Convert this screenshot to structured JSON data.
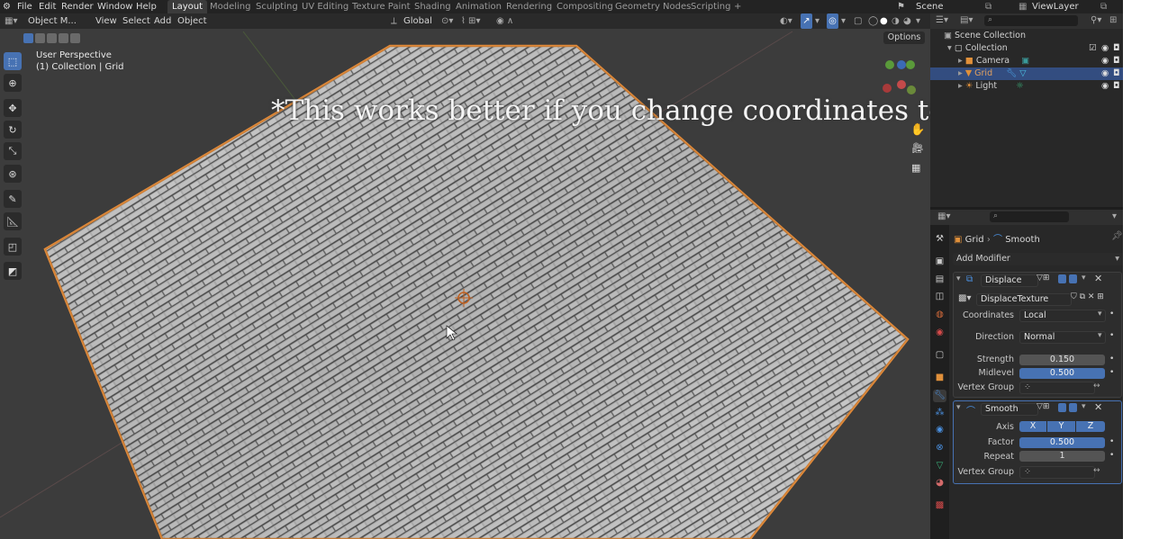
{
  "menu": [
    "File",
    "Edit",
    "Render",
    "Window",
    "Help"
  ],
  "workspaces": [
    "Layout",
    "Modeling",
    "Sculpting",
    "UV Editing",
    "Texture Paint",
    "Shading",
    "Animation",
    "Rendering",
    "Compositing",
    "Geometry Nodes",
    "Scripting",
    "+"
  ],
  "scene": "Scene",
  "view_layer": "ViewLayer",
  "viewport_header": {
    "mode": "Object M...",
    "items": [
      "View",
      "Select",
      "Add",
      "Object"
    ],
    "transform": "Global",
    "options": "Options"
  },
  "viewport": {
    "view_name": "User Perspective",
    "collection_label": "(1) Collection | Grid",
    "caption": "*This works better if you change coordinates to UV",
    "accent_color": "#4772b3"
  },
  "outliner": {
    "root": "Scene Collection",
    "collection": "Collection",
    "items": [
      {
        "name": "Camera",
        "icon": "camera-icon"
      },
      {
        "name": "Grid",
        "icon": "mesh-icon"
      },
      {
        "name": "Light",
        "icon": "light-icon"
      }
    ]
  },
  "properties": {
    "breadcrumb_object": "Grid",
    "breadcrumb_modifier": "Smooth",
    "add_modifier": "Add Modifier",
    "displace": {
      "name": "Displace",
      "texture": "DisplaceTexture",
      "coordinates_label": "Coordinates",
      "coordinates_value": "Local",
      "direction_label": "Direction",
      "direction_value": "Normal",
      "strength_label": "Strength",
      "strength_value": "0.150",
      "midlevel_label": "Midlevel",
      "midlevel_value": "0.500",
      "vertex_group_label": "Vertex Group"
    },
    "smooth": {
      "name": "Smooth",
      "axis_label": "Axis",
      "axis_x": "X",
      "axis_y": "Y",
      "axis_z": "Z",
      "factor_label": "Factor",
      "factor_value": "0.500",
      "repeat_label": "Repeat",
      "repeat_value": "1",
      "vertex_group_label": "Vertex Group"
    }
  }
}
